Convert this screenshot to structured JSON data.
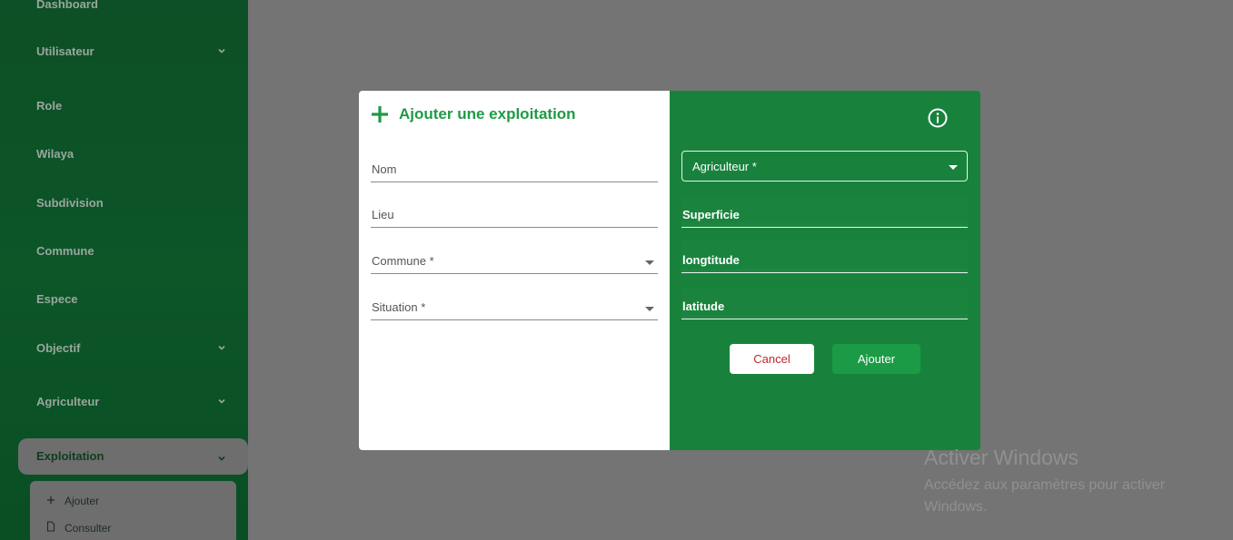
{
  "sidebar": {
    "items": [
      {
        "label": "Dashboard"
      },
      {
        "label": "Utilisateur"
      },
      {
        "label": "Role"
      },
      {
        "label": "Wilaya"
      },
      {
        "label": "Subdivision"
      },
      {
        "label": "Commune"
      },
      {
        "label": "Espece"
      },
      {
        "label": "Objectif"
      },
      {
        "label": "Agriculteur"
      },
      {
        "label": "Exploitation"
      }
    ],
    "submenu": [
      {
        "label": "Ajouter",
        "icon": "plus-icon"
      },
      {
        "label": "Consulter",
        "icon": "file-icon"
      }
    ]
  },
  "modal": {
    "title": "Ajouter une exploitation",
    "left_fields": {
      "nom": "Nom",
      "lieu": "Lieu",
      "commune": "Commune *",
      "situation": "Situation *"
    },
    "right_fields": {
      "agriculteur": "Agriculteur *",
      "superficie": "Superficie",
      "longtitude": "longtitude",
      "latitude": "latitude"
    },
    "cancel_label": "Cancel",
    "add_label": "Ajouter"
  },
  "watermark": {
    "title": "Activer Windows",
    "subtitle": "Accédez aux paramètres pour activer Windows."
  },
  "colors": {
    "sidebar": "#0c5628",
    "accent_green": "#18823d",
    "title_green": "#1f9a45",
    "cancel_text": "#c1272d",
    "overlay": "#747474"
  }
}
